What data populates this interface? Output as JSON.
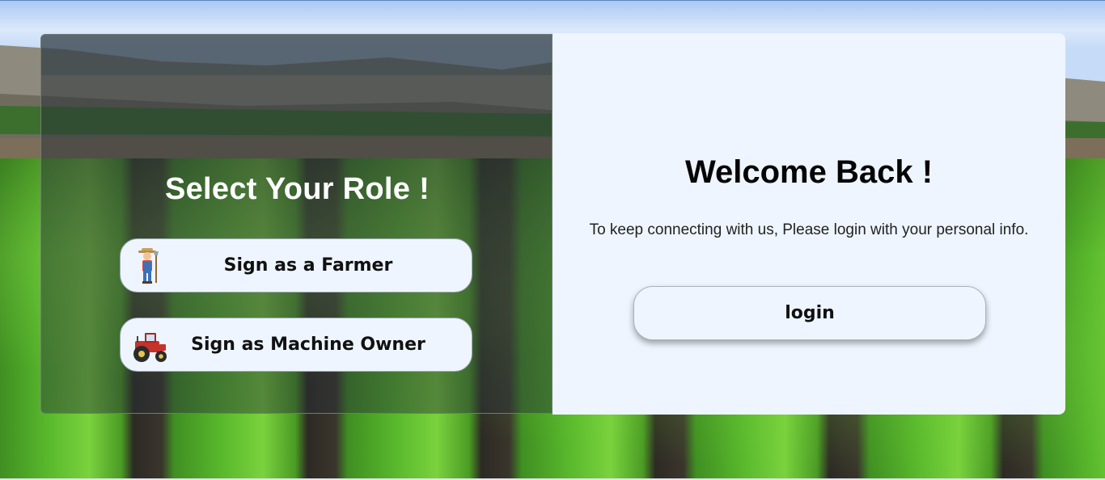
{
  "role_panel": {
    "title": "Select Your Role !",
    "buttons": [
      {
        "label": "Sign as a Farmer",
        "icon": "farmer-icon"
      },
      {
        "label": "Sign as Machine Owner",
        "icon": "tractor-icon"
      }
    ]
  },
  "welcome_panel": {
    "title": "Welcome Back !",
    "subtitle": "To keep connecting with us, Please login with your personal info.",
    "login_label": "login"
  },
  "colors": {
    "panel_bg": "#eef5fe",
    "overlay": "#283036",
    "field_green": "#59b92c",
    "tractor_red": "#c8302a"
  }
}
